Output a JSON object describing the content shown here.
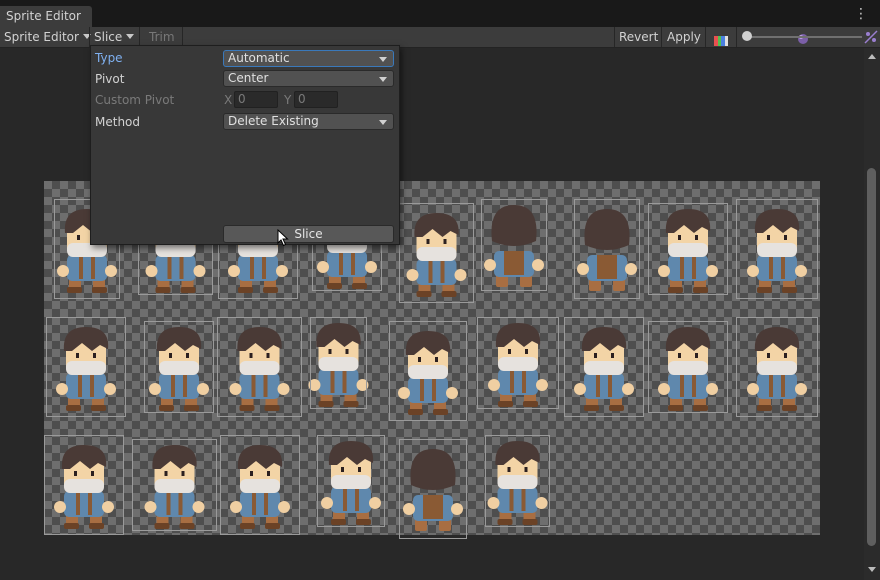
{
  "window": {
    "tab_title": "Sprite Editor",
    "menu_icon": "kebab-menu-icon"
  },
  "toolbar": {
    "mode_label": "Sprite Editor",
    "slice_label": "Slice",
    "trim_label": "Trim",
    "revert_label": "Revert",
    "apply_label": "Apply",
    "color_channel_icon": "rgb-channel-icon",
    "mip_icon": "mip-level-icon",
    "zoom_level": 0.02
  },
  "slice_popup": {
    "type_label": "Type",
    "type_value": "Automatic",
    "pivot_label": "Pivot",
    "pivot_value": "Center",
    "custom_pivot_label": "Custom Pivot",
    "x_label": "X",
    "x_value": "0",
    "y_label": "Y",
    "y_value": "0",
    "method_label": "Method",
    "method_value": "Delete Existing",
    "slice_button": "Slice"
  },
  "colors": {
    "accent": "#7fb0f0",
    "focus_border": "#3a79bb",
    "background": "#282828",
    "toolbar": "#3c3c3c"
  },
  "sprite_sheet": {
    "rows": 3,
    "sprites_per_row": [
      9,
      9,
      6
    ]
  }
}
